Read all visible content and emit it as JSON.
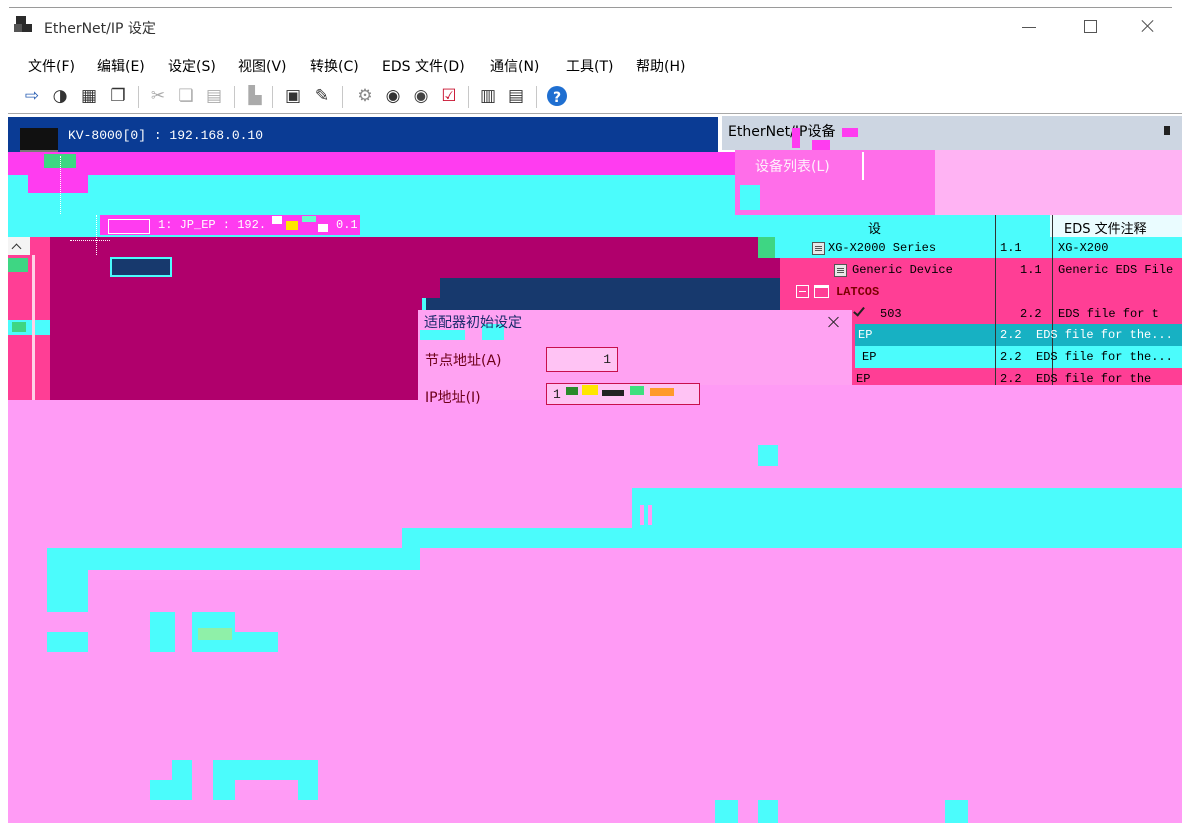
{
  "window": {
    "title": "EtherNet/IP 设定"
  },
  "menu": [
    {
      "label": "文件(F)"
    },
    {
      "label": "编辑(E)"
    },
    {
      "label": "设定(S)"
    },
    {
      "label": "视图(V)"
    },
    {
      "label": "转换(C)"
    },
    {
      "label": "EDS 文件(D)"
    },
    {
      "label": "通信(N)"
    },
    {
      "label": "工具(T)"
    },
    {
      "label": "帮助(H)"
    }
  ],
  "toolbar": {
    "icons": [
      "transfer-icon",
      "monitor-icon",
      "network-icon",
      "compare-icon",
      "cut-icon",
      "copy-icon",
      "paste-icon",
      "add-device-icon",
      "sd-card-icon",
      "edit-icon",
      "settings-icon",
      "eds-register-icon",
      "eip-icon",
      "check-icon",
      "property-icon",
      "list-icon",
      "help-icon"
    ]
  },
  "controller_pane": {
    "header": "KV-8000[0] : 192.168.0.10",
    "node_label_start": "1: JP_EP : 192.",
    "node_label_end": "0.1"
  },
  "device_pane": {
    "title": "EtherNet/IP设备",
    "list_label": "设备列表(L)",
    "column_name": "设",
    "column_comment": "EDS 文件注释",
    "rows": [
      {
        "name": "XG-X2000 Series",
        "version": "1.1",
        "comment": "XG-X200"
      },
      {
        "name": "Generic Device",
        "version": "1.1",
        "comment": "Generic EDS File"
      },
      {
        "name": "LATCOS"
      },
      {
        "name": "503",
        "version": "2.2",
        "comment": "EDS file for t"
      },
      {
        "name": "EP",
        "version": "2.2",
        "comment": "EDS file for the..."
      },
      {
        "name": "EP",
        "version": "2.2",
        "comment": "EDS file for the..."
      },
      {
        "name": "EP",
        "version": "2.2",
        "comment": "EDS file for the"
      }
    ]
  },
  "dialog": {
    "title": "适配器初始设定",
    "node_address_label": "节点地址(A)",
    "node_address_value": "1",
    "ip_label": "IP地址(I)",
    "ip_value": "1"
  },
  "colors": {
    "header_blue": "#0a3b94",
    "glitch_pink": "#ff9bf5",
    "glitch_pink_mid": "#ff6ee9",
    "glitch_pink_light": "#ffb3f3",
    "glitch_cyan": "#4bfcfc",
    "glitch_magenta": "#ff3cf0",
    "glitch_dark_magenta": "#b0006c",
    "glitch_hot_pink": "#ff3e95",
    "glitch_navy": "#17396d",
    "glitch_green": "#3ed683",
    "glitch_teal": "#17b1c3",
    "latcos_red": "#7a0000"
  }
}
